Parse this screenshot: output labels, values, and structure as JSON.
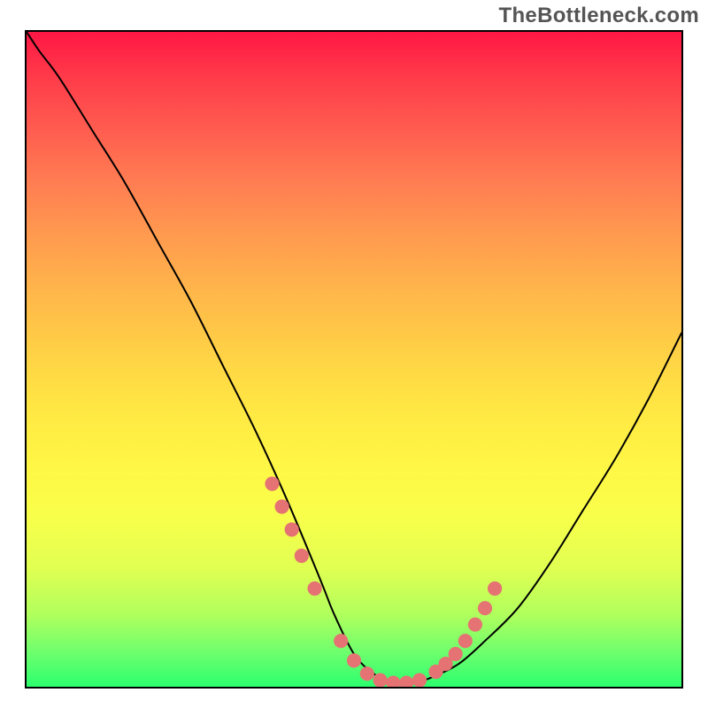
{
  "watermark": "TheBottleneck.com",
  "chart_data": {
    "type": "line",
    "title": "",
    "xlabel": "",
    "ylabel": "",
    "xlim": [
      0,
      100
    ],
    "ylim": [
      0,
      100
    ],
    "grid": false,
    "note": "x/y are in percent of the inner plotting area (0,0 = bottom-left, 100,100 = top-right). Values are read from the pixel geometry of the curve.",
    "series": [
      {
        "name": "bottleneck-curve",
        "color": "#000000",
        "x": [
          0,
          2,
          5,
          10,
          15,
          20,
          25,
          30,
          35,
          40,
          45,
          47,
          50,
          53,
          56,
          59,
          62,
          66,
          70,
          75,
          80,
          85,
          90,
          95,
          100
        ],
        "y": [
          100,
          97,
          93,
          85,
          77,
          68,
          59,
          49,
          39,
          28,
          16,
          11,
          5,
          2,
          0.5,
          0.5,
          1.5,
          3.5,
          7,
          12,
          19,
          27,
          35,
          44,
          54
        ]
      }
    ],
    "markers": {
      "name": "hotspot-markers",
      "color": "#e57373",
      "radius_pct": 1.1,
      "points_xy_pct": [
        [
          37.5,
          31
        ],
        [
          39,
          27.5
        ],
        [
          40.5,
          24
        ],
        [
          42,
          20
        ],
        [
          44,
          15
        ],
        [
          48,
          7
        ],
        [
          50,
          4
        ],
        [
          52,
          2
        ],
        [
          54,
          1
        ],
        [
          56,
          0.6
        ],
        [
          58,
          0.6
        ],
        [
          60,
          1
        ],
        [
          62.5,
          2.3
        ],
        [
          64,
          3.5
        ],
        [
          65.5,
          5
        ],
        [
          67,
          7
        ],
        [
          68.5,
          9.5
        ],
        [
          70,
          12
        ],
        [
          71.5,
          15
        ]
      ]
    },
    "background_gradient": {
      "direction": "top_to_bottom",
      "stops": [
        {
          "pos": 0.0,
          "color": "#ff1744"
        },
        {
          "pos": 0.5,
          "color": "#ffd445"
        },
        {
          "pos": 0.74,
          "color": "#f8ff4a"
        },
        {
          "pos": 1.0,
          "color": "#2cff6e"
        }
      ]
    }
  }
}
